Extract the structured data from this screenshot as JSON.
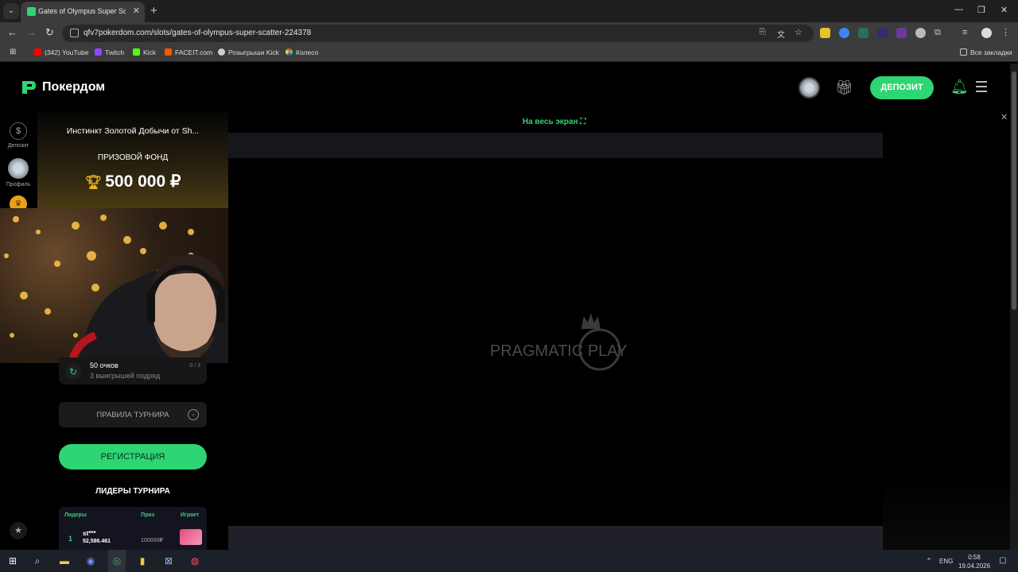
{
  "browser": {
    "tab_title": "Gates of Olympus Super Sc",
    "url": "qfv7pokerdom.com/slots/gates-of-olympus-super-scatter-224378",
    "bookmarks": [
      "(342) YouTube",
      "Twitch",
      "Kick",
      "FACEIT.com",
      "Розыгрыши Kick",
      "Колесо"
    ],
    "bookmark_colors": [
      "#ff0000",
      "#9146ff",
      "#53fc18",
      "#ff5500",
      "#cccccc",
      "#cccccc"
    ],
    "all_bookmarks": "Все закладки"
  },
  "site": {
    "logo": "Покердом",
    "deposit_button": "ДЕПОЗИТ",
    "rail": {
      "deposit": "Депозит",
      "profile": "Профиль"
    },
    "accent_color": "#2ed573"
  },
  "tournament": {
    "name": "Инстинкт Золотой Добычи от Sh...",
    "prize_label": "ПРИЗОВОЙ ФОНД",
    "prize_amount": "500 000 ₽",
    "task": {
      "title": "50 очков",
      "subtitle": "3 выигрышей подряд",
      "progress": "0 / 3"
    },
    "rules_label": "ПРАВИЛА ТУРНИРА",
    "register_button": "РЕГИСТРАЦИЯ",
    "leaders_title": "ЛИДЕРЫ ТУРНИРА",
    "leaderboard": {
      "headers": {
        "leaders": "Лидеры",
        "prize": "Приз",
        "plays": "Играет"
      },
      "rows": [
        {
          "rank": "1",
          "name": "st***",
          "score": "52,586.461",
          "prize": "100000₽"
        }
      ]
    }
  },
  "game": {
    "fullscreen_label": "На весь экран",
    "provider": "PRAGMATIC PLAY"
  },
  "taskbar": {
    "lang": "ENG",
    "time": "0:58",
    "date": "19.04.2026"
  }
}
